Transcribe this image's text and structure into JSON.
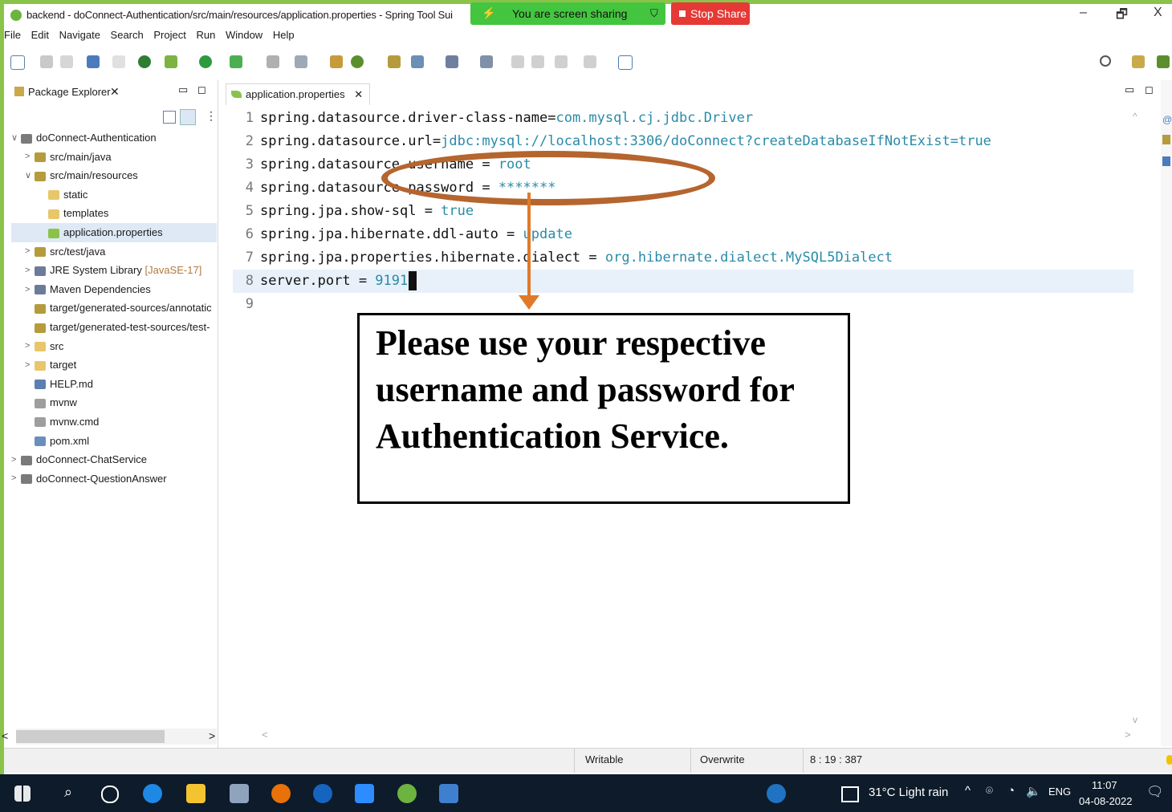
{
  "window": {
    "title": "backend - doConnect-Authentication/src/main/resources/application.properties - Spring Tool Sui",
    "min": "–",
    "restore": "🗗",
    "close": "X"
  },
  "screen_share": {
    "label": "You are screen sharing",
    "stop_label": "Stop Share"
  },
  "menu": [
    "File",
    "Edit",
    "Navigate",
    "Search",
    "Project",
    "Run",
    "Window",
    "Help"
  ],
  "package_explorer": {
    "title": "Package Explorer",
    "items": [
      {
        "label": "doConnect-Authentication",
        "indent": 0,
        "arrow": "∨",
        "icon": "project",
        "color": "#7a7a7a"
      },
      {
        "label": "src/main/java",
        "indent": 1,
        "arrow": ">",
        "icon": "package",
        "color": "#b59b3c"
      },
      {
        "label": "src/main/resources",
        "indent": 1,
        "arrow": "∨",
        "icon": "package",
        "color": "#b59b3c"
      },
      {
        "label": "static",
        "indent": 2,
        "arrow": "",
        "icon": "folder",
        "color": "#e8c66a"
      },
      {
        "label": "templates",
        "indent": 2,
        "arrow": "",
        "icon": "folder",
        "color": "#e8c66a"
      },
      {
        "label": "application.properties",
        "indent": 2,
        "arrow": "",
        "icon": "file",
        "color": "#8bc34a",
        "selected": true
      },
      {
        "label": "src/test/java",
        "indent": 1,
        "arrow": ">",
        "icon": "package",
        "color": "#b59b3c"
      },
      {
        "label": "JRE System Library",
        "suffix": " [JavaSE-17]",
        "indent": 1,
        "arrow": ">",
        "icon": "library",
        "color": "#6b7c9a"
      },
      {
        "label": "Maven Dependencies",
        "indent": 1,
        "arrow": ">",
        "icon": "library",
        "color": "#6b7c9a"
      },
      {
        "label": "target/generated-sources/annotatic",
        "indent": 1,
        "arrow": "",
        "icon": "package",
        "color": "#b59b3c"
      },
      {
        "label": "target/generated-test-sources/test-",
        "indent": 1,
        "arrow": "",
        "icon": "package",
        "color": "#b59b3c"
      },
      {
        "label": "src",
        "indent": 1,
        "arrow": ">",
        "icon": "folder",
        "color": "#e8c66a"
      },
      {
        "label": "target",
        "indent": 1,
        "arrow": ">",
        "icon": "folder",
        "color": "#e8c66a"
      },
      {
        "label": "HELP.md",
        "indent": 1,
        "arrow": "",
        "icon": "file",
        "color": "#5a7fb0"
      },
      {
        "label": "mvnw",
        "indent": 1,
        "arrow": "",
        "icon": "file",
        "color": "#9e9e9e"
      },
      {
        "label": "mvnw.cmd",
        "indent": 1,
        "arrow": "",
        "icon": "file",
        "color": "#9e9e9e"
      },
      {
        "label": "pom.xml",
        "indent": 1,
        "arrow": "",
        "icon": "file",
        "color": "#6a8fbf"
      },
      {
        "label": "doConnect-ChatService",
        "indent": 0,
        "arrow": ">",
        "icon": "project",
        "color": "#7a7a7a"
      },
      {
        "label": "doConnect-QuestionAnswer",
        "indent": 0,
        "arrow": ">",
        "icon": "project",
        "color": "#7a7a7a"
      }
    ]
  },
  "editor": {
    "tab": "application.properties",
    "lines": [
      {
        "n": "1",
        "key": "spring.datasource.driver-class-name=",
        "val": "com.mysql.cj.jdbc.Driver"
      },
      {
        "n": "2",
        "key": "spring.datasource.url=",
        "val": "jdbc:mysql://localhost:3306/doConnect?createDatabaseIfNotExist=true"
      },
      {
        "n": "3",
        "key": "spring.datasource.username = ",
        "val": "root"
      },
      {
        "n": "4",
        "key": "spring.datasource.password = ",
        "val": "*******"
      },
      {
        "n": "5",
        "key": "spring.jpa.show-sql = ",
        "val": "true"
      },
      {
        "n": "6",
        "key": "spring.jpa.hibernate.ddl-auto = ",
        "val": "update"
      },
      {
        "n": "7",
        "key": "spring.jpa.properties.hibernate.dialect = ",
        "val": "org.hibernate.dialect.MySQL5Dialect"
      },
      {
        "n": "8",
        "key": "server.port = ",
        "val": "9191"
      },
      {
        "n": "9",
        "key": "",
        "val": ""
      }
    ]
  },
  "annotation": {
    "text": "Please use your respective username and password for Authentication Service."
  },
  "status": {
    "writable": "Writable",
    "mode": "Overwrite",
    "position": "8 : 19 : 387"
  },
  "taskbar": {
    "weather": "31°C  Light rain",
    "lang": "ENG",
    "time": "11:07",
    "date": "04-08-2022"
  },
  "colors": {
    "accent_green": "#8bc34a",
    "value_teal": "#2a8ba8",
    "annotation_oval": "#b5652e",
    "annotation_arrow": "#e07a2a"
  }
}
